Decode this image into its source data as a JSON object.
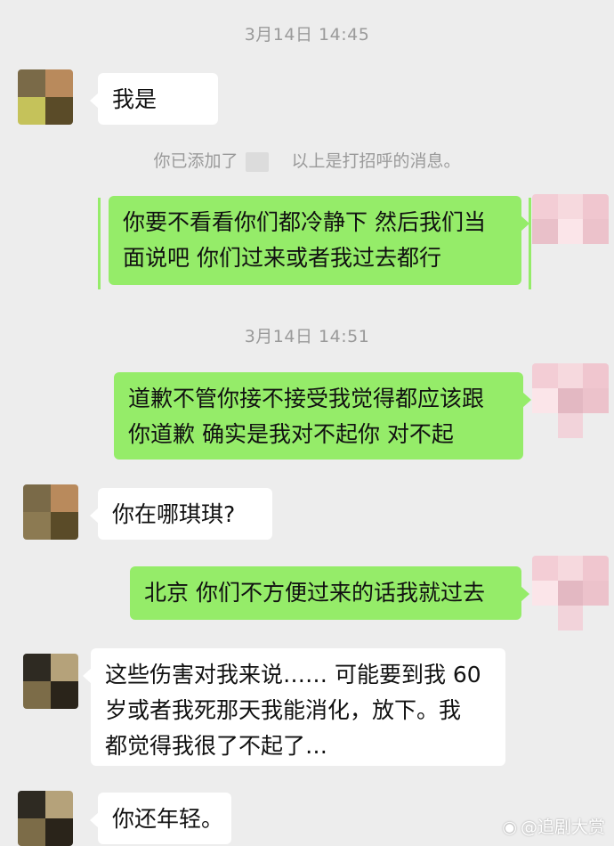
{
  "colors": {
    "background": "#ededed",
    "incoming_bubble": "#ffffff",
    "outgoing_bubble": "#95ec69",
    "timestamp": "#9a9a9a"
  },
  "timestamps": [
    "3月14日 14:45",
    "3月14日 14:51"
  ],
  "system_notice": {
    "prefix": "你已添加了",
    "suffix": "以上是打招呼的消息。"
  },
  "messages": [
    {
      "from": "other",
      "lines": [
        "我是"
      ]
    },
    {
      "from": "me",
      "lines": [
        "你要不看看你们都冷静下 然后我们当",
        "面说吧 你们过来或者我过去都行"
      ]
    },
    {
      "from": "me",
      "lines": [
        "道歉不管你接不接受我觉得都应该跟",
        "你道歉 确实是我对不起你 对不起"
      ]
    },
    {
      "from": "other",
      "lines": [
        "你在哪琪琪?"
      ]
    },
    {
      "from": "me",
      "lines": [
        "北京 你们不方便过来的话我就过去"
      ]
    },
    {
      "from": "other",
      "lines": [
        "这些伤害对我来说…… 可能要到我 60",
        "岁或者我死那天我能消化，放下。我",
        "都觉得我很了不起了…"
      ]
    },
    {
      "from": "other",
      "lines": [
        "你还年轻。"
      ]
    }
  ],
  "watermark": {
    "icon": "weibo-icon",
    "text": "@追剧大赏"
  }
}
